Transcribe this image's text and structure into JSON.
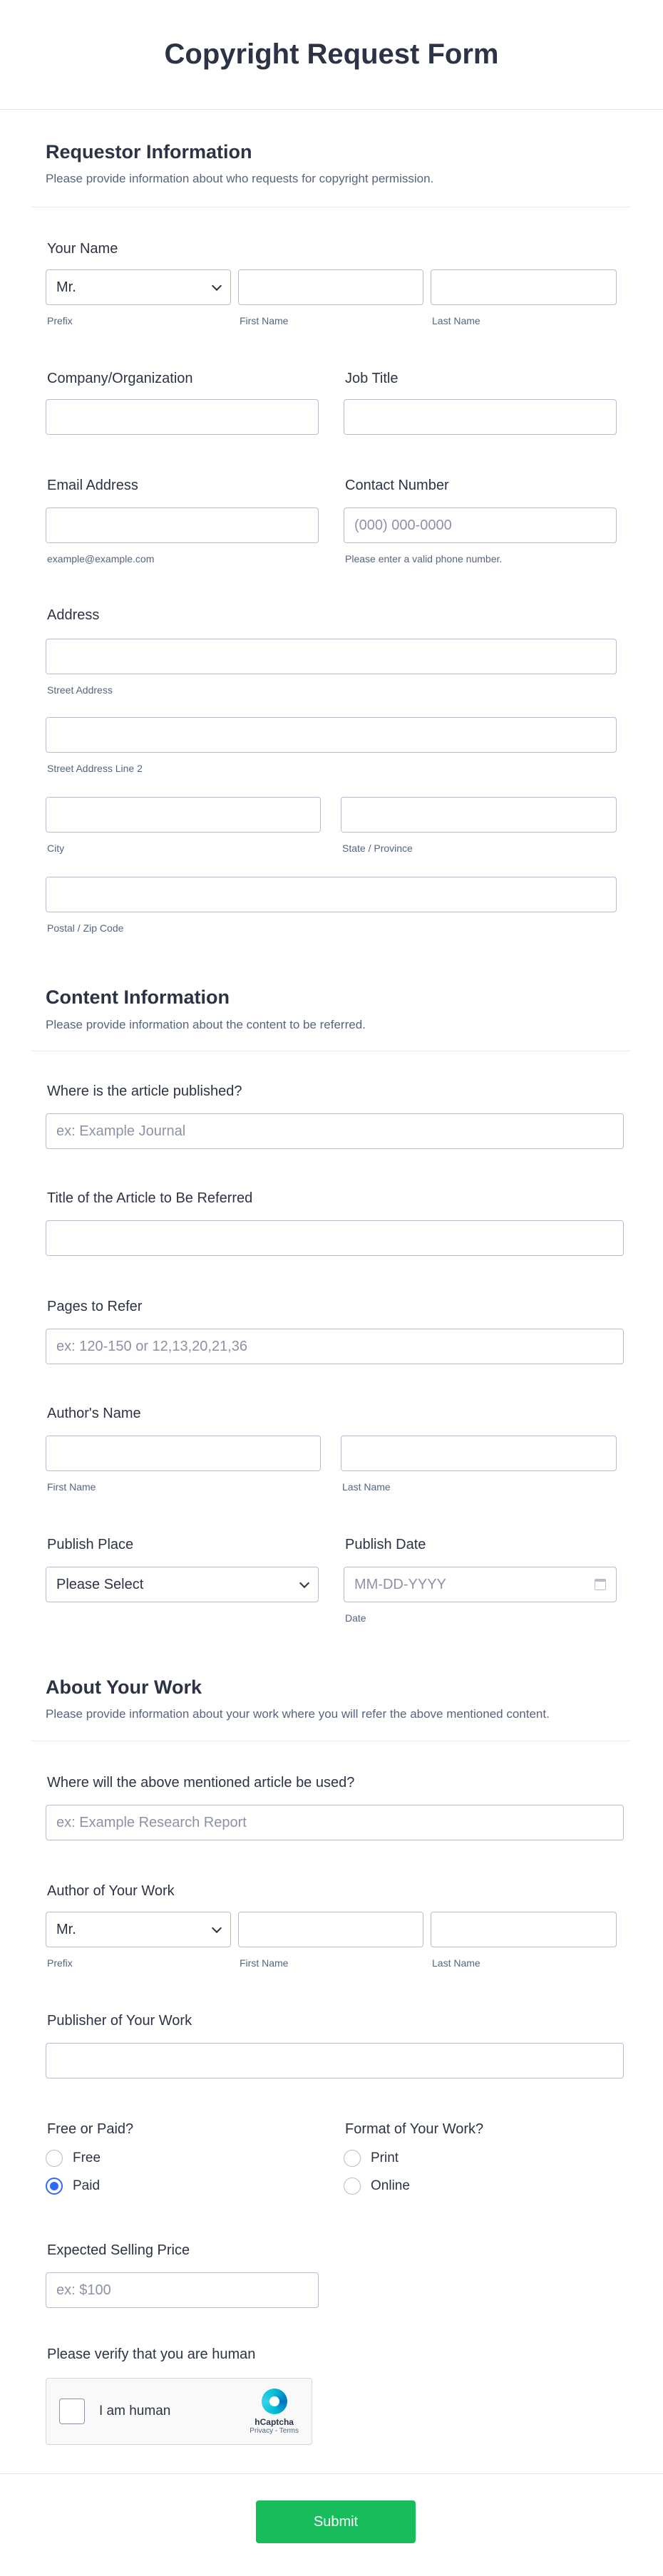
{
  "form_title": "Copyright Request Form",
  "sections": {
    "requestor": {
      "title": "Requestor Information",
      "desc": "Please provide information about who requests for copyright permission."
    },
    "content": {
      "title": "Content Information",
      "desc": "Please provide information about the content to be referred."
    },
    "work": {
      "title": "About Your Work",
      "desc": "Please provide information about your work where you will refer the above mentioned content."
    }
  },
  "fields": {
    "your_name": {
      "label": "Your Name",
      "prefix_value": "Mr.",
      "prefix_sub": "Prefix",
      "first_sub": "First Name",
      "last_sub": "Last Name"
    },
    "company": {
      "label": "Company/Organization"
    },
    "job_title": {
      "label": "Job Title"
    },
    "email": {
      "label": "Email Address",
      "sub": "example@example.com"
    },
    "phone": {
      "label": "Contact Number",
      "placeholder": "(000) 000-0000",
      "sub": "Please enter a valid phone number."
    },
    "address": {
      "label": "Address",
      "street_sub": "Street Address",
      "street2_sub": "Street Address Line 2",
      "city_sub": "City",
      "state_sub": "State / Province",
      "zip_sub": "Postal / Zip Code"
    },
    "published_where": {
      "label": "Where is the article published?",
      "placeholder": "ex: Example Journal"
    },
    "article_title": {
      "label": "Title of the Article to Be Referred"
    },
    "pages": {
      "label": "Pages to Refer",
      "placeholder": "ex: 120-150 or 12,13,20,21,36"
    },
    "author": {
      "label": "Author's Name",
      "first_sub": "First Name",
      "last_sub": "Last Name"
    },
    "publish_place": {
      "label": "Publish Place",
      "value": "Please Select"
    },
    "publish_date": {
      "label": "Publish Date",
      "placeholder": "MM-DD-YYYY",
      "sub": "Date"
    },
    "usage": {
      "label": "Where will the above mentioned article be used?",
      "placeholder": "ex: Example Research Report"
    },
    "work_author": {
      "label": "Author of Your Work",
      "prefix_value": "Mr.",
      "prefix_sub": "Prefix",
      "first_sub": "First Name",
      "last_sub": "Last Name"
    },
    "publisher": {
      "label": "Publisher of Your Work"
    },
    "free_paid": {
      "label": "Free or Paid?",
      "options": [
        "Free",
        "Paid"
      ],
      "selected": "Paid"
    },
    "format": {
      "label": "Format of Your Work?",
      "options": [
        "Print",
        "Online"
      ],
      "selected": ""
    },
    "price": {
      "label": "Expected Selling Price",
      "placeholder": "ex: $100"
    },
    "captcha": {
      "label": "Please verify that you are human",
      "text": "I am human",
      "brand": "hCaptcha",
      "links": "Privacy - Terms"
    }
  },
  "submit_label": "Submit",
  "colors": {
    "submit": "#18bd5b",
    "radio_selected": "#2e69ff"
  }
}
